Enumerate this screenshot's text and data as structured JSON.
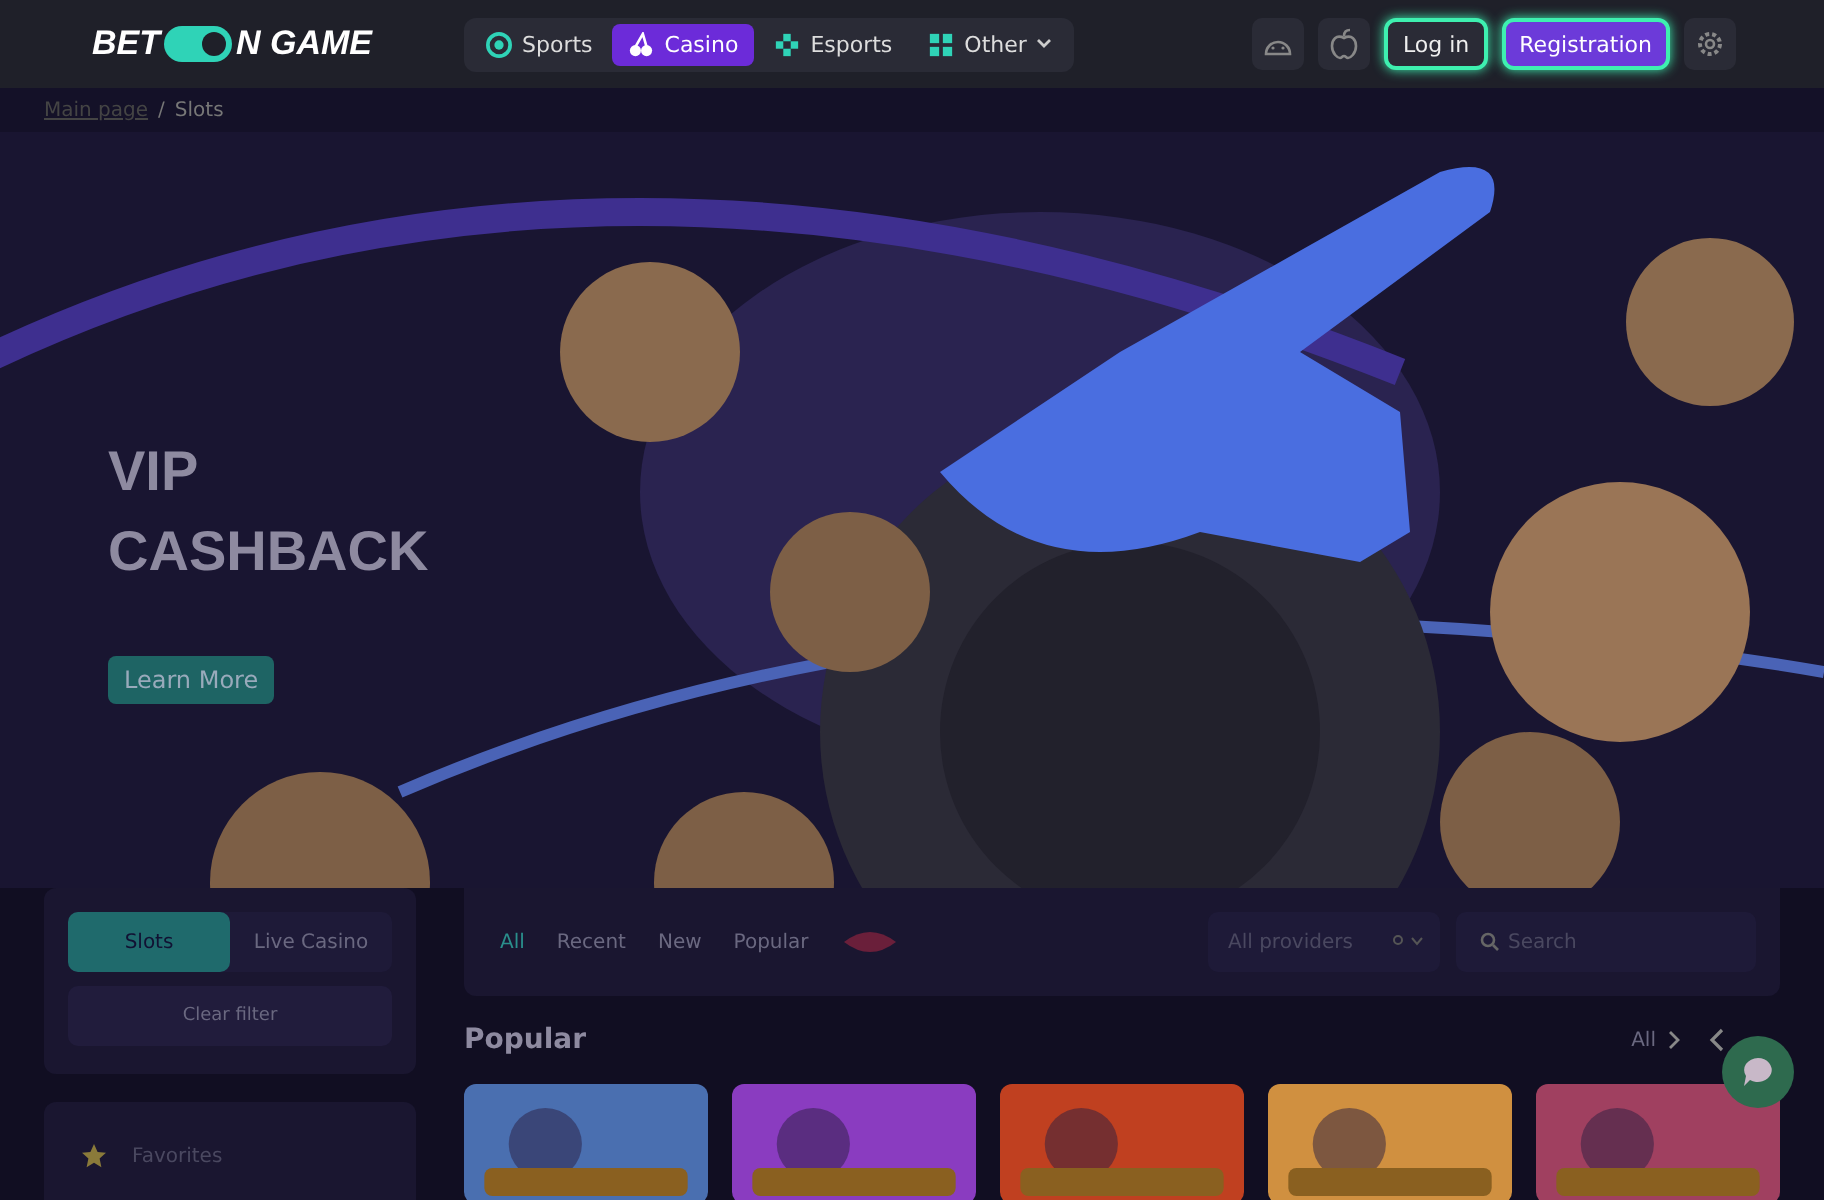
{
  "header": {
    "logo": {
      "left": "BET",
      "right": "N GAME"
    },
    "nav": [
      {
        "label": "Sports",
        "selected": false
      },
      {
        "label": "Casino",
        "selected": true
      },
      {
        "label": "Esports",
        "selected": false
      },
      {
        "label": "Other",
        "selected": false
      }
    ],
    "login": "Log in",
    "register": "Registration"
  },
  "breadcrumb": {
    "link": "Main page",
    "separator": "/",
    "current": "Slots"
  },
  "banner": {
    "kind": "picture",
    "title": "VIP\nCASHBACK",
    "button": "Learn More"
  },
  "sidebar": {
    "tabs": [
      {
        "label": "Slots",
        "selected": true
      },
      {
        "label": "Live Casino",
        "selected": false
      }
    ],
    "clear": "Clear filter",
    "items": [
      {
        "label": "Favorites"
      }
    ]
  },
  "filters": {
    "tabs": [
      {
        "label": "All",
        "selected": true
      },
      {
        "label": "Recent",
        "selected": false
      },
      {
        "label": "New",
        "selected": false
      },
      {
        "label": "Popular",
        "selected": false
      }
    ],
    "providers_placeholder": "All providers",
    "search_placeholder": "Search"
  },
  "section": {
    "title": "Popular",
    "all": "All"
  }
}
